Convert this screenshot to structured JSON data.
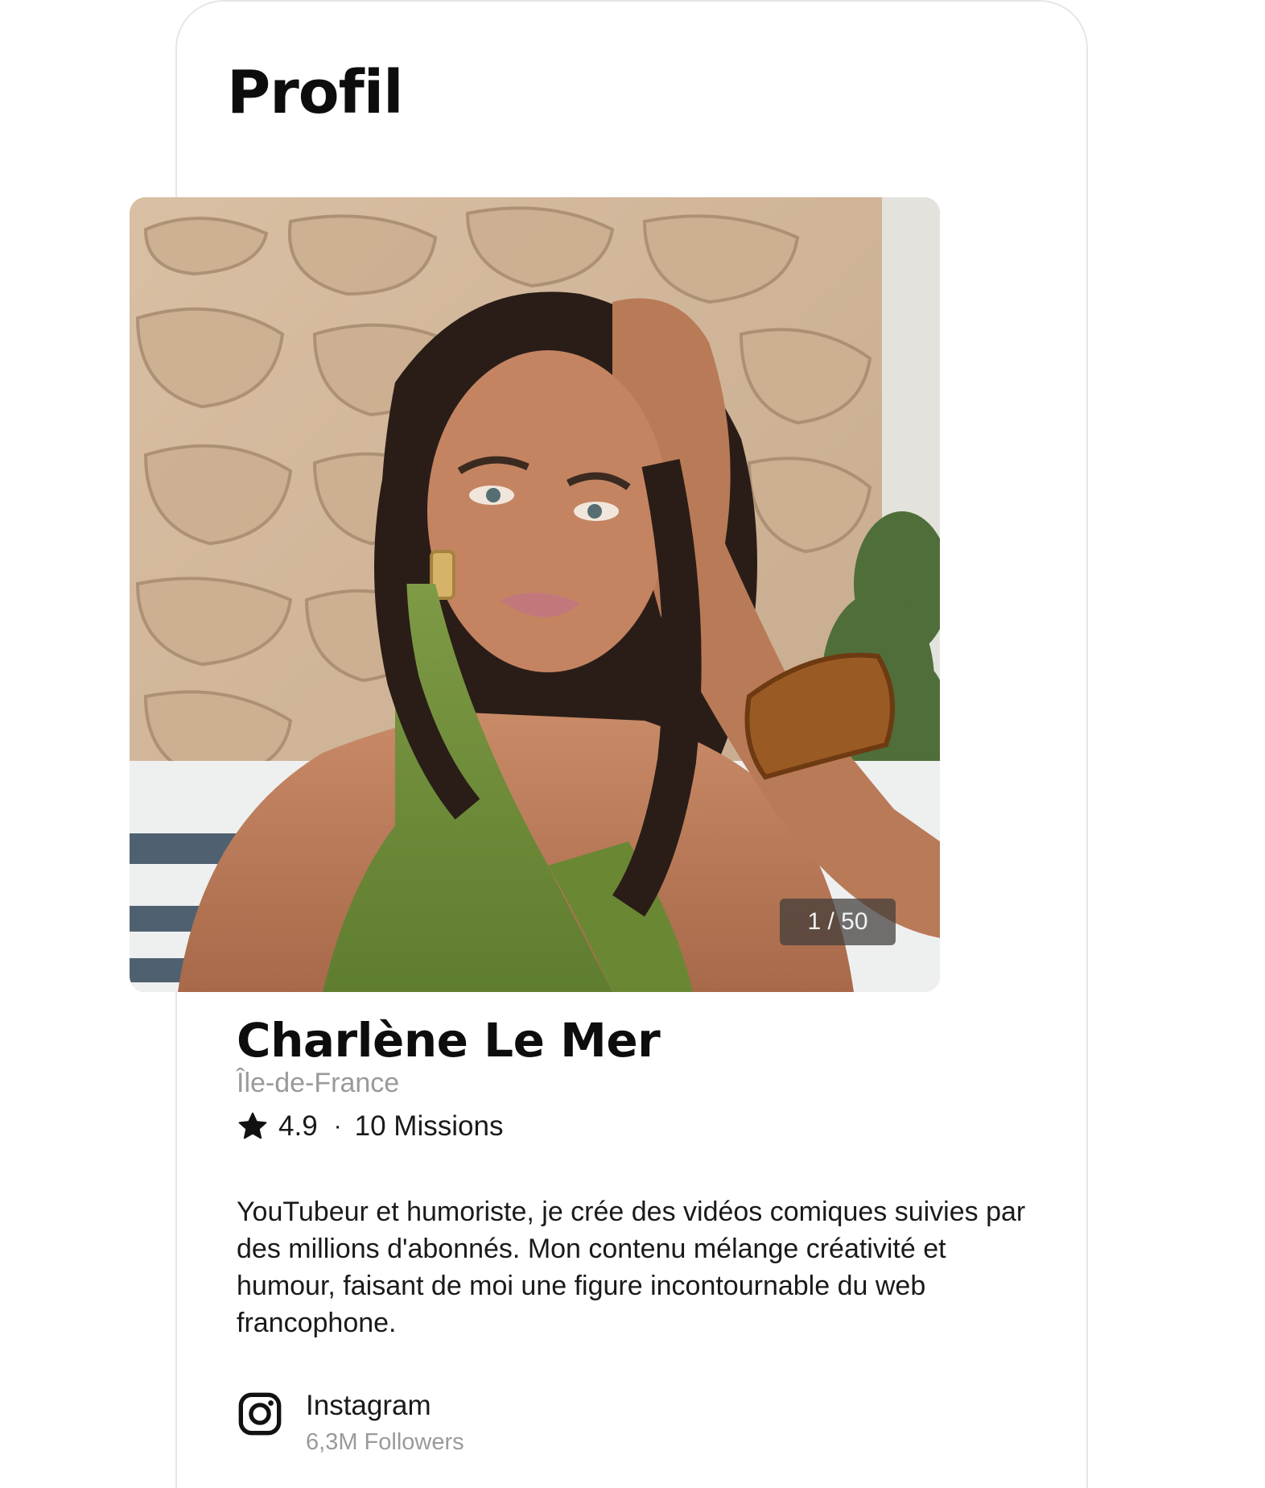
{
  "header": {
    "title": "Profil"
  },
  "gallery": {
    "counter": "1 / 50",
    "current": 1,
    "total": 50
  },
  "profile": {
    "name": "Charlène Le Mer",
    "location": "Île-de-France",
    "rating": "4.9",
    "separator": "·",
    "missions": "10 Missions",
    "bio": "YouTubeur et humoriste, je crée des vidéos comiques suivies par des millions d'abonnés. Mon contenu mélange créativité et humour, faisant de moi une figure incontournable du web francophone."
  },
  "social": [
    {
      "icon": "instagram-icon",
      "network": "Instagram",
      "followers": "6,3M Followers"
    }
  ],
  "colors": {
    "text": "#111111",
    "muted": "#9a9a9a",
    "counter_bg": "#403c3a"
  }
}
